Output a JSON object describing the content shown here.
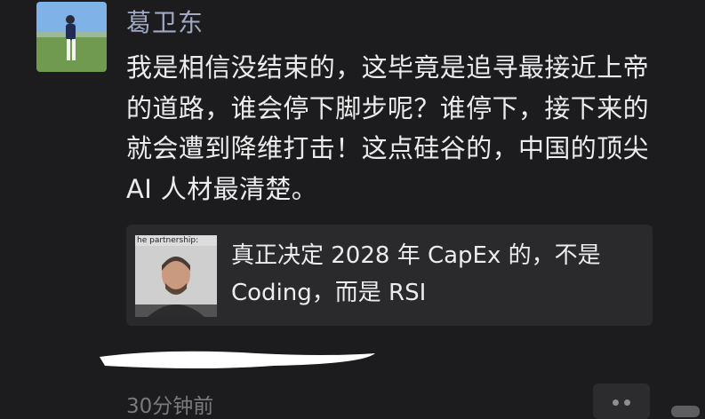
{
  "post": {
    "author_name": "葛卫东",
    "avatar": "avatar-photo",
    "text": "我是相信没结束的，这毕竟是追寻最接近上帝的道路，谁会停下脚步呢？谁停下，接下来的就会遭到降维打击！这点硅谷的，中国的顶尖 AI 人材最清楚。",
    "timestamp": "30分钟前"
  },
  "link_card": {
    "thumbnail_caption": "he partnership:",
    "title": "真正决定 2028 年 CapEx 的，不是 Coding，而是 RSI"
  },
  "actions": {
    "more_icon": "two-dots-icon"
  },
  "colors": {
    "background": "#1c1c1e",
    "author_name": "#a0a9c4",
    "text": "#ececed",
    "card_background": "#2a2a2c",
    "timestamp": "#7a7a7e"
  }
}
